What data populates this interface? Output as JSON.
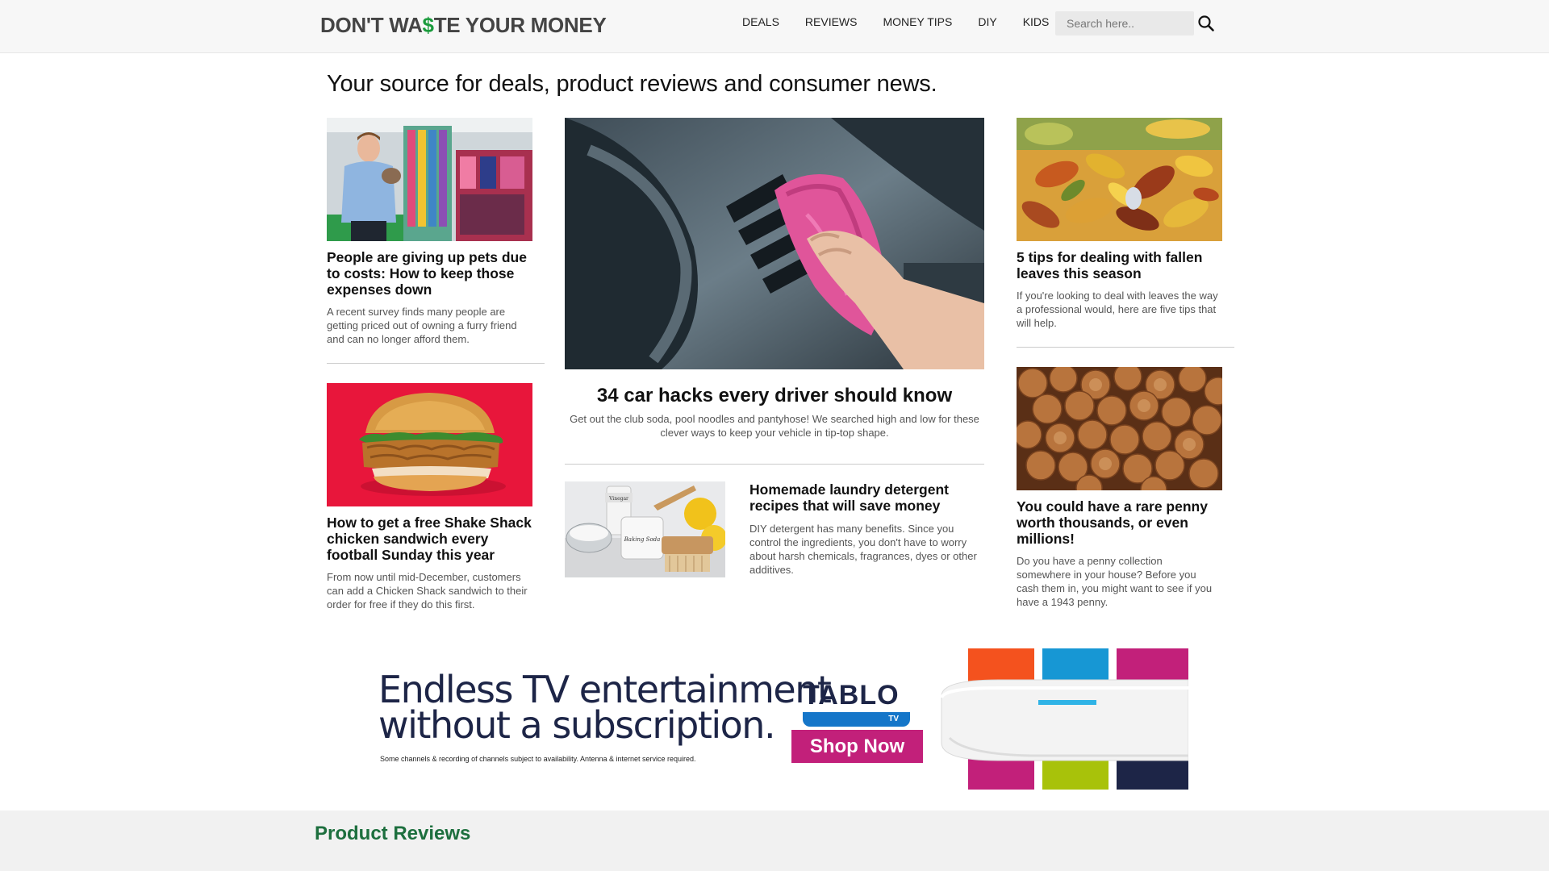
{
  "header": {
    "logo_part1": "DON'T WA",
    "logo_dollar": "$",
    "logo_part2": "TE YOUR MONEY",
    "nav": [
      "DEALS",
      "REVIEWS",
      "MONEY TIPS",
      "DIY",
      "KIDS"
    ],
    "search_placeholder": "Search here.."
  },
  "tagline": "Your source for deals, product reviews and consumer news.",
  "articles": {
    "pets": {
      "title": "People are giving up pets due to costs: How to keep those expenses down",
      "desc": "A recent survey finds many people are getting priced out of owning a furry friend and can no longer afford them."
    },
    "shake": {
      "title": "How to get a free Shake Shack chicken sandwich every football Sunday this year",
      "desc": "From now until mid-December, customers can add a Chicken Shack sandwich to their order for free if they do this first."
    },
    "car": {
      "title": "34 car hacks every driver should know",
      "desc": "Get out the club soda, pool noodles and pantyhose! We searched high and low for these clever ways to keep your vehicle in tip-top shape."
    },
    "laundry": {
      "title": "Homemade laundry detergent recipes that will save money",
      "desc": "DIY detergent has many benefits. Since you control the ingredients, you don't have to worry about harsh chemicals, fragrances, dyes or other additives.",
      "jar_label": "Baking Soda",
      "bottle_label": "Vinegar"
    },
    "leaves": {
      "title": "5 tips for dealing with fallen leaves this season",
      "desc": "If you're looking to deal with leaves the way a professional would, here are five tips that will help."
    },
    "penny": {
      "title": "You could have a rare penny worth thousands, or even millions!",
      "desc": "Do you have a penny collection somewhere in your house? Before you cash them in, you might want to see if you have a 1943 penny."
    }
  },
  "ad": {
    "headline_1": "Endless TV entertainment",
    "headline_2": "without a subscription.",
    "fine_print": "Some channels & recording of channels subject to availability. Antenna & internet service required.",
    "brand": "TABLO",
    "brand_sub": "TV",
    "cta": "Shop Now",
    "tile_colors": [
      "#f4521e",
      "#1797d4",
      "#c2207a",
      "#a8c20a",
      "#c2207a",
      "#1d2547"
    ]
  },
  "section": {
    "title": "Product Reviews"
  },
  "colors": {
    "accent_green": "#1d6f3e",
    "logo_dollar": "#1a9b3c",
    "ad_pink": "#c2207a"
  }
}
